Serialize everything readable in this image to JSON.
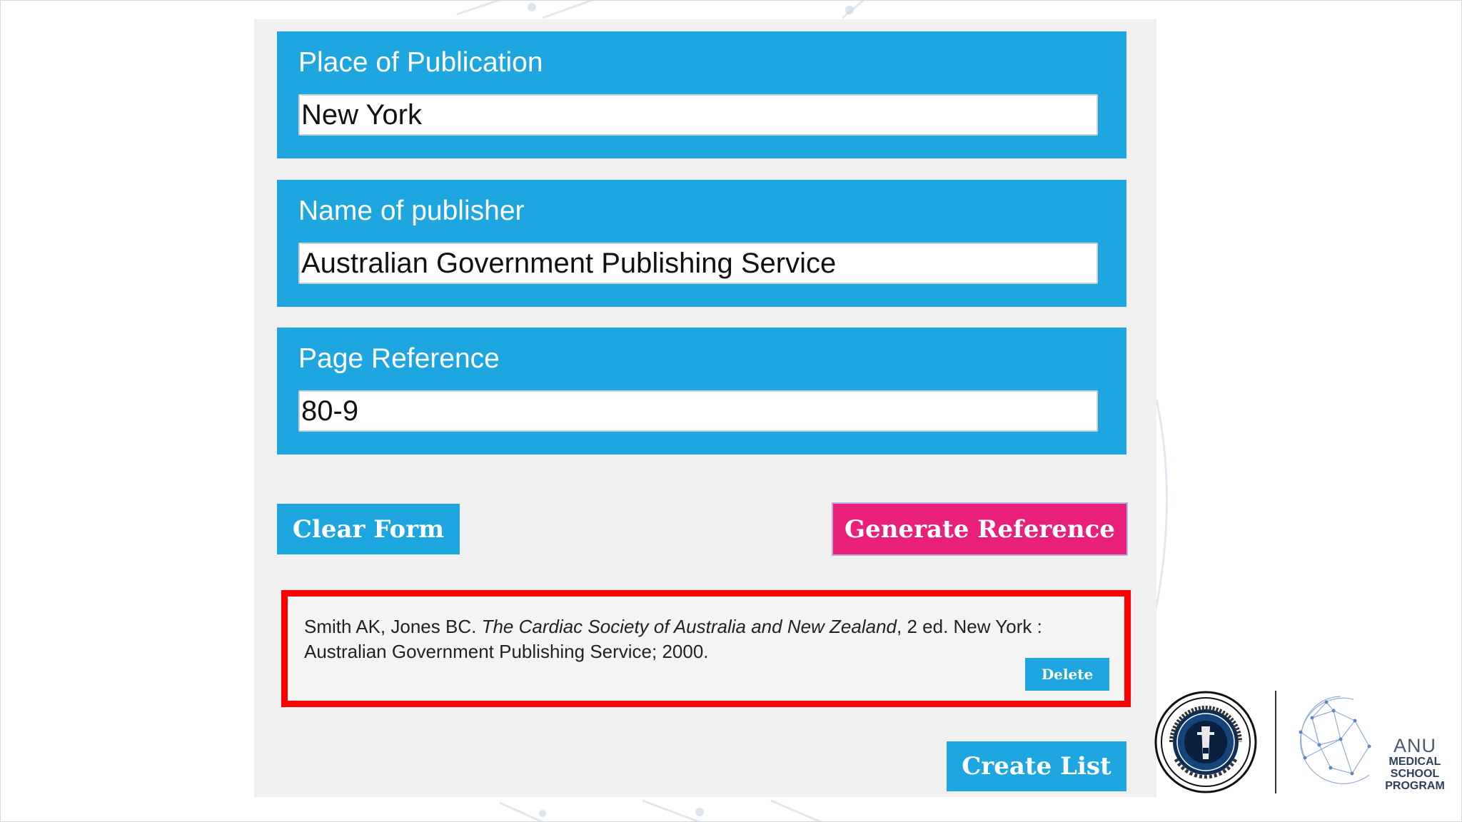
{
  "form": {
    "fields": [
      {
        "label": "Place of Publication",
        "value": "New York"
      },
      {
        "label": "Name of publisher",
        "value": "Australian Government Publishing Service"
      },
      {
        "label": "Page Reference",
        "value": "80-9"
      }
    ],
    "clear_label": "Clear Form",
    "generate_label": "Generate Reference"
  },
  "result": {
    "authors": "Smith AK, Jones BC.",
    "title": "The Cardiac Society of Australia and New Zealand",
    "details": ", 2 ed. New York : Australian Government Publishing Service; 2000.",
    "delete_label": "Delete"
  },
  "create_list_label": "Create List",
  "logos": {
    "anu_line1": "ANU",
    "anu_line2": "MEDICAL",
    "anu_line3": "SCHOOL",
    "anu_line4": "PROGRAM"
  },
  "colors": {
    "field_background": "#1ea6e1",
    "generate_button": "#e8207a",
    "highlight_border": "#ff0000"
  }
}
